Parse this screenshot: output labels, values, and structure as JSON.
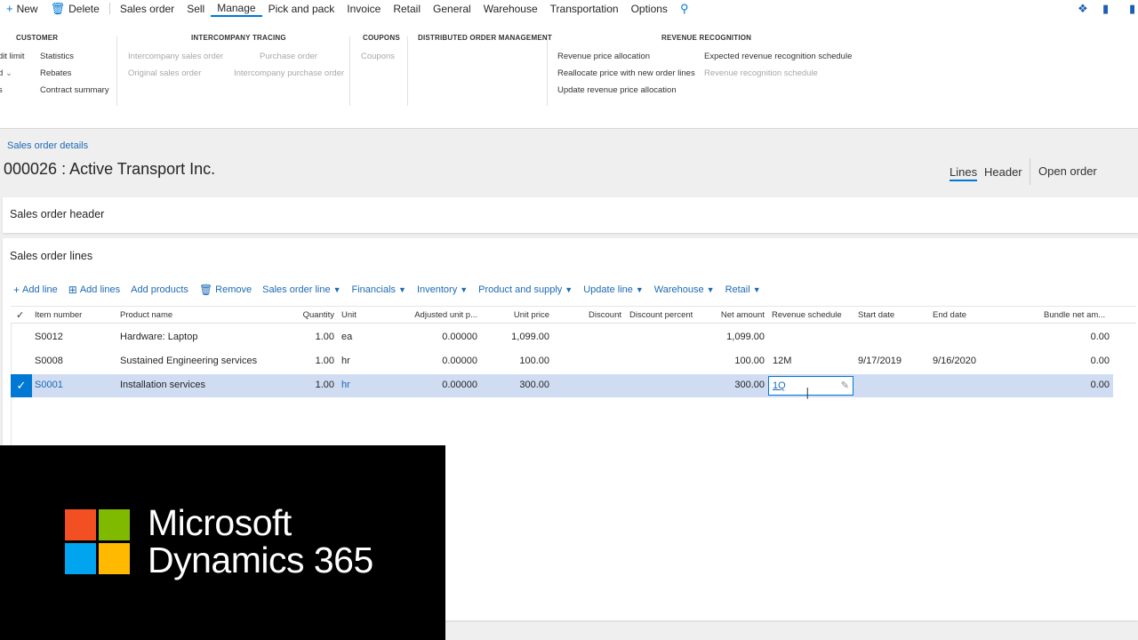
{
  "topbar": {
    "new_label": "New",
    "delete_label": "Delete",
    "tabs": [
      "Sales order",
      "Sell",
      "Manage",
      "Pick and pack",
      "Invoice",
      "Retail",
      "General",
      "Warehouse",
      "Transportation",
      "Options"
    ],
    "active_tab": "Manage"
  },
  "ribbon": {
    "customer": {
      "title": "CUSTOMER",
      "col1": [
        "dit limit",
        "d",
        "s"
      ],
      "col2": [
        "Statistics",
        "Rebates",
        "Contract summary"
      ]
    },
    "intercompany": {
      "title": "INTERCOMPANY TRACING",
      "items": [
        "Intercompany sales order",
        "Original sales order",
        "Purchase order",
        "Intercompany purchase order"
      ]
    },
    "coupons": {
      "title": "COUPONS",
      "items": [
        "Coupons"
      ]
    },
    "dom": {
      "title": "DISTRIBUTED ORDER MANAGEMENT"
    },
    "revenue": {
      "title": "REVENUE RECOGNITION",
      "col1": [
        "Revenue price allocation",
        "Reallocate price with new order lines",
        "Update revenue price allocation"
      ],
      "col2": [
        "Expected revenue recognition schedule",
        "Revenue recognition schedule"
      ]
    }
  },
  "page": {
    "breadcrumb": "Sales order details",
    "title": "000026 : Active Transport Inc.",
    "view_tabs": [
      "Lines",
      "Header"
    ],
    "open_order": "Open order"
  },
  "header_section": {
    "title": "Sales order header"
  },
  "lines_section": {
    "title": "Sales order lines",
    "toolbar": {
      "add_line": "Add line",
      "add_lines": "Add lines",
      "add_products": "Add products",
      "remove": "Remove",
      "menus": [
        "Sales order line",
        "Financials",
        "Inventory",
        "Product and supply",
        "Update line",
        "Warehouse",
        "Retail"
      ]
    },
    "columns": [
      "Item number",
      "Product name",
      "Quantity",
      "Unit",
      "Adjusted unit p...",
      "Unit price",
      "Discount",
      "Discount percent",
      "Net amount",
      "Revenue schedule",
      "Start date",
      "End date",
      "Bundle net am..."
    ],
    "rows": [
      {
        "item": "S0012",
        "product": "Hardware: Laptop",
        "qty": "1.00",
        "unit": "ea",
        "adj": "0.00000",
        "price": "1,099.00",
        "net": "1,099.00",
        "schedule": "",
        "start": "",
        "end": "",
        "bundle": "0.00"
      },
      {
        "item": "S0008",
        "product": "Sustained Engineering services",
        "qty": "1.00",
        "unit": "hr",
        "adj": "0.00000",
        "price": "100.00",
        "net": "100.00",
        "schedule": "12M",
        "start": "9/17/2019",
        "end": "9/16/2020",
        "bundle": "0.00"
      },
      {
        "item": "S0001",
        "product": "Installation services",
        "qty": "1.00",
        "unit": "hr",
        "adj": "0.00000",
        "price": "300.00",
        "net": "300.00",
        "schedule": "1Q",
        "start": "",
        "end": "",
        "bundle": "0.00"
      }
    ]
  },
  "brand": {
    "line1": "Microsoft",
    "line2": "Dynamics 365",
    "colors": [
      "#f25022",
      "#7fba00",
      "#00a4ef",
      "#ffb900"
    ]
  }
}
